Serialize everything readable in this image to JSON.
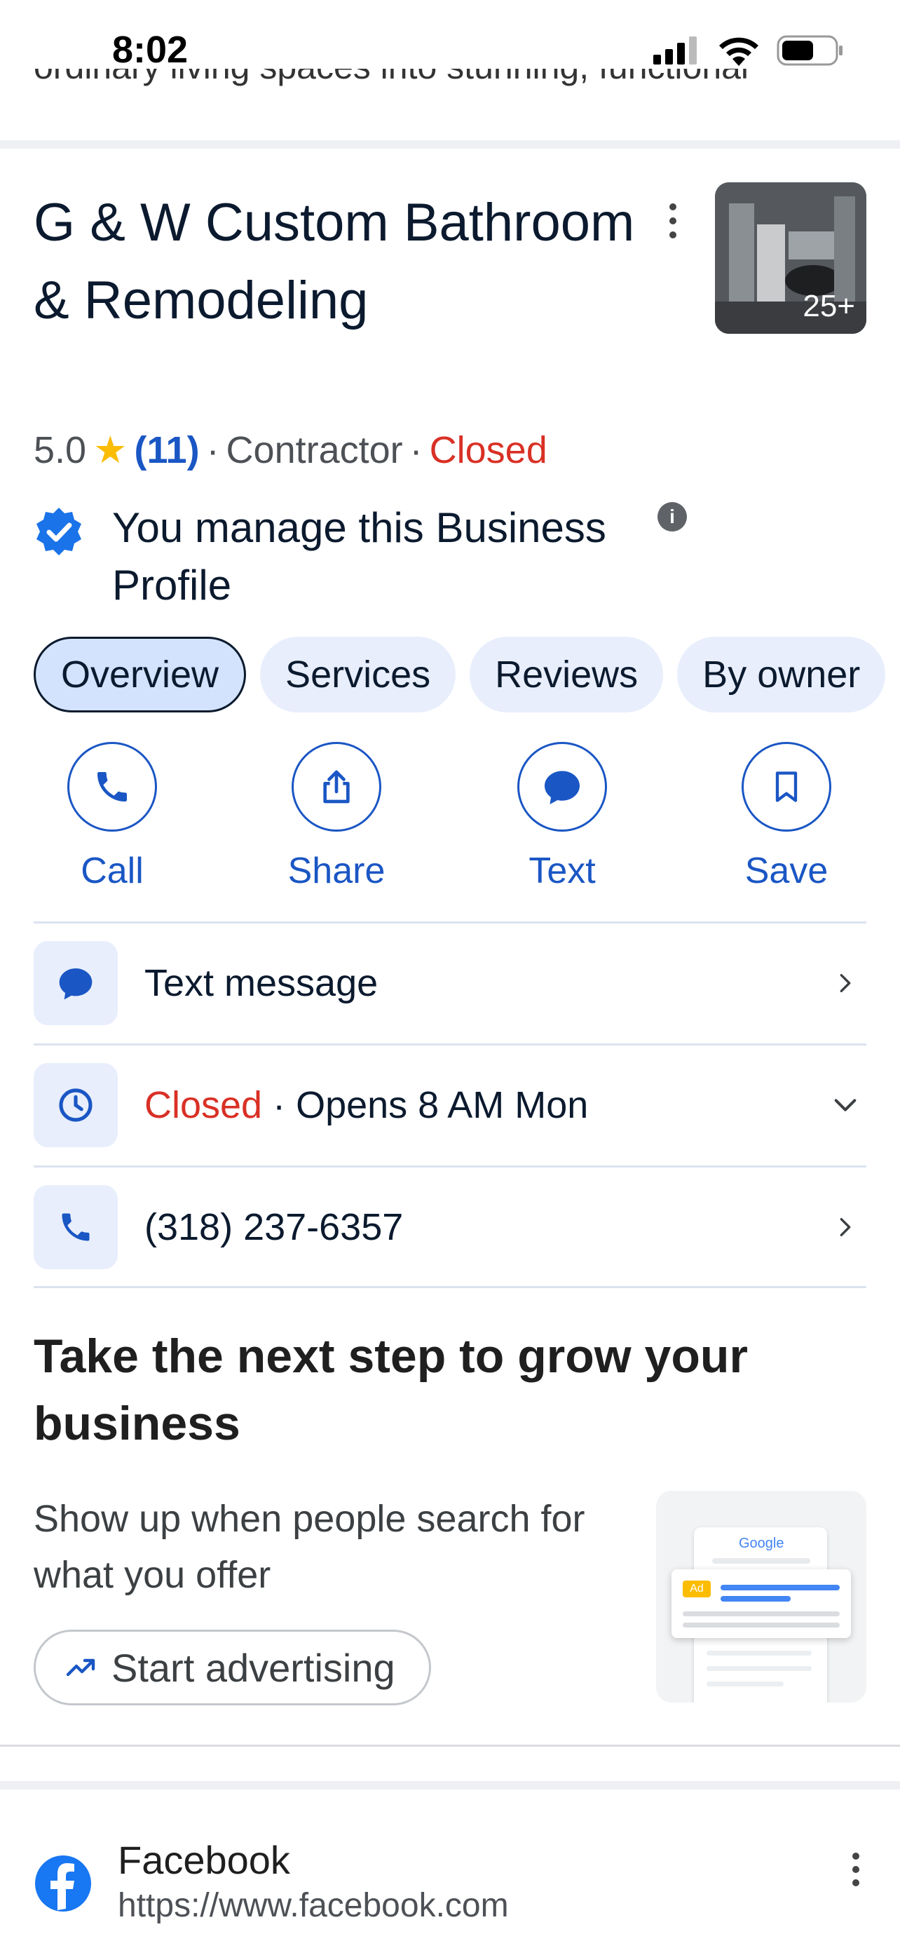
{
  "status_bar": {
    "time": "8:02"
  },
  "cutoff_text": "ordinary living spaces into stunning, functional",
  "business": {
    "name": "G & W Custom Bathroom & Remodeling",
    "photo_count": "25+",
    "rating": "5.0",
    "star": "★",
    "review_count": "(11)",
    "sep1": "·",
    "category": "Contractor",
    "sep2": "·",
    "status": "Closed",
    "managed_text": "You manage this Business Profile"
  },
  "tabs": [
    {
      "label": "Overview",
      "active": true
    },
    {
      "label": "Services"
    },
    {
      "label": "Reviews"
    },
    {
      "label": "By owner"
    }
  ],
  "actions": [
    {
      "label": "Call",
      "icon": "phone-icon"
    },
    {
      "label": "Share",
      "icon": "share-icon"
    },
    {
      "label": "Text",
      "icon": "chat-bubble-icon"
    },
    {
      "label": "Save",
      "icon": "bookmark-icon"
    }
  ],
  "rows": {
    "text_message": "Text message",
    "hours_status": "Closed",
    "hours_detail": " · Opens 8 AM Mon",
    "phone": "(318) 237-6357"
  },
  "grow": {
    "title": "Take the next step to grow your business",
    "description": "Show up when people search for what you offer",
    "button": "Start advertising",
    "promo_logo": "Google",
    "promo_ad_badge": "Ad"
  },
  "result": {
    "name": "Facebook",
    "url": "https://www.facebook.com"
  },
  "colors": {
    "accent_blue": "#1a56c4",
    "closed_red": "#d93025",
    "chip_bg": "#e8eefc"
  }
}
